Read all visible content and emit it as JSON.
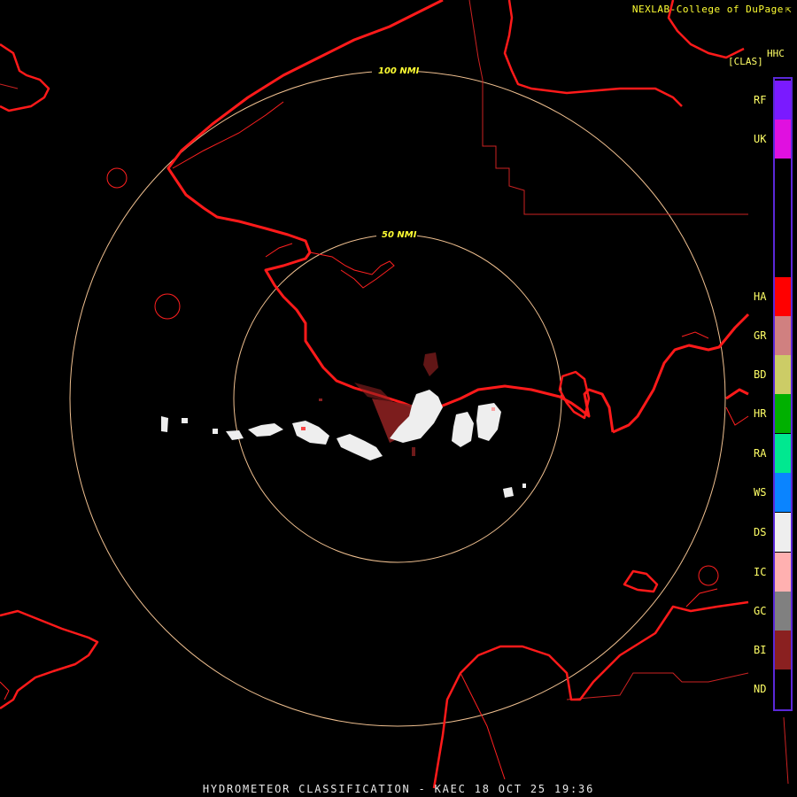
{
  "credit": "NEXLAB-College of DuPage",
  "product": {
    "code": "HHC",
    "units": "[CLAS]"
  },
  "rings": [
    {
      "label": "100 NMI",
      "radius_nmi": 100
    },
    {
      "label": "50 NMI",
      "radius_nmi": 50
    }
  ],
  "legend": [
    {
      "code": "RF",
      "color": "#7a1aff"
    },
    {
      "code": "UK",
      "color": "#e010e0"
    },
    {
      "code": "HA",
      "color": "#ff0000"
    },
    {
      "code": "GR",
      "color": "#d08080"
    },
    {
      "code": "BD",
      "color": "#cccc66"
    },
    {
      "code": "HR",
      "color": "#00b000"
    },
    {
      "code": "RA",
      "color": "#00e890"
    },
    {
      "code": "WS",
      "color": "#0a84ff"
    },
    {
      "code": "DS",
      "color": "#eeeeee"
    },
    {
      "code": "IC",
      "color": "#ffb0b0"
    },
    {
      "code": "GC",
      "color": "#808080"
    },
    {
      "code": "BI",
      "color": "#8a2020"
    },
    {
      "code": "ND",
      "color": "#000000"
    }
  ],
  "footer": "HYDROMETEOR CLASSIFICATION - KAEC 18 OCT 25 19:36",
  "colors": {
    "coast": "#ff1a1a",
    "border": "#cc2222",
    "ring": "#f0c090",
    "ring_label": "#ffff33"
  }
}
